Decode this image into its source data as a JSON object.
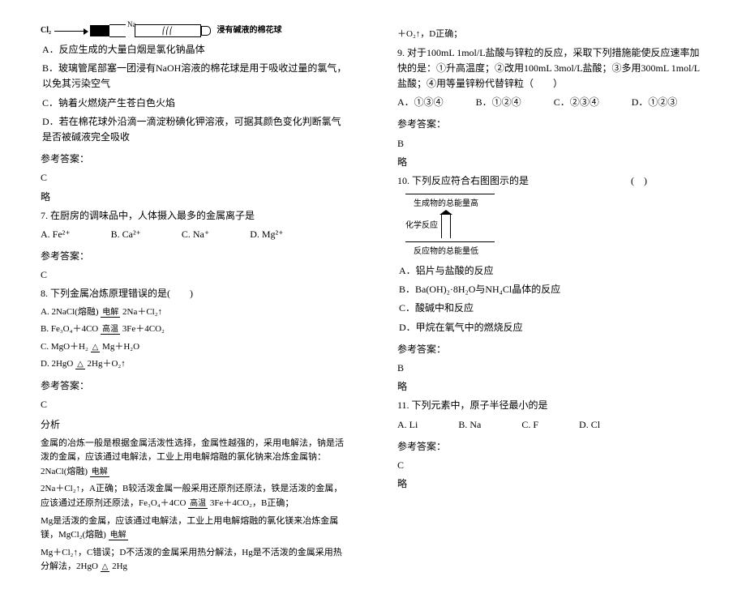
{
  "left": {
    "diagram": {
      "cl2": "Cl₂",
      "na": "Na",
      "cotton": "浸有碱液的棉花球"
    },
    "q_opts": {
      "A": "A．反应生成的大量白烟是氯化钠晶体",
      "B": "B．玻璃管尾部塞一团浸有NaOH溶液的棉花球是用于吸收过量的氯气，以免其污染空气",
      "C": "C．钠着火燃烧产生苍白色火焰",
      "D": "D．若在棉花球外沿滴一滴淀粉碘化钾溶液，可据其颜色变化判断氯气是否被碱液完全吸收"
    },
    "ref": "参考答案：",
    "ans6": "C",
    "omit": "略",
    "q7": "7. 在厨房的调味品中，人体摄入最多的金属离子是",
    "q7opts": {
      "A": "A. Fe²⁺",
      "B": "B. Ca²⁺",
      "C": "C. Na⁺",
      "D": "D. Mg²⁺"
    },
    "ans7": "C",
    "q8": "8. 下列金属冶炼原理错误的是(　　)",
    "q8A": "A. 2NaCl(熔融) ",
    "q8A_cond": "电解",
    "q8A_tail": " 2Na＋Cl₂↑",
    "q8B": "B. Fe₃O₄＋4CO ",
    "q8B_cond": "高温",
    "q8B_tail": " 3Fe＋4CO₂",
    "q8C": "C. MgO＋H₂ ",
    "q8C_cond": "△",
    "q8C_tail": " Mg＋H₂O",
    "q8D": "D. 2HgO ",
    "q8D_cond": "△",
    "q8D_tail": " 2Hg＋O₂↑",
    "ans8": "C",
    "analysis_label": "分析",
    "analysis_p1a": "金属的冶炼一般是根据金属活泼性选择，金属性越强的，采用电解法，钠是活泼的金属，应该通过电解法，工业上用电解熔融的氯化钠来冶炼金属钠：2NaCl(熔融) ",
    "analysis_cond1": "电解",
    "analysis_p1b": " 2Na＋Cl₂↑，A正确；B较活泼金属一般采用还原剂还原法，铁是活泼的金属，应该通过还原剂还原法，Fe₃O₄＋4CO ",
    "analysis_cond2": "高温",
    "analysis_p1c": " 3Fe＋4CO₂，B正确；",
    "analysis_p2a": "Mg是活泼的金属，应该通过电解法，工业上用电解熔融的氯化镁来冶炼金属镁，MgCl₂(熔融) ",
    "analysis_cond3": "电解",
    "analysis_p2b": " Mg＋Cl₂↑，C错误；D不活泼的金属采用热分解法，Hg是不活泼的金属采用热分解法，2HgO ",
    "analysis_cond4": "△",
    "analysis_p2c": " 2Hg"
  },
  "right": {
    "top_tail": "＋O₂↑，D正确；",
    "q9": "9. 对于100mL 1mol/L盐酸与锌粒的反应，采取下列措施能使反应速率加快的是：①升高温度；②改用100mL 3mol/L盐酸；③多用300mL 1mol/L盐酸；④用等量锌粉代替锌粒（　　）",
    "q9opts": {
      "A": "A．①③④",
      "B": "B．①②④",
      "C": "C．②③④",
      "D": "D．①②③"
    },
    "ref": "参考答案：",
    "ans9": "B",
    "omit": "略",
    "q10": "10. 下列反应符合右图图示的是",
    "q10_blank": "(　)",
    "energy": {
      "top": "生成物的总能量高",
      "mid": "化学反应",
      "bottom": "反应物的总能量低"
    },
    "q10opts": {
      "A": "A．铝片与盐酸的反应",
      "B": "B．Ba(OH)₂·8H₂O与NH₄Cl晶体的反应",
      "C": "C．酸碱中和反应",
      "D": "D．甲烷在氧气中的燃烧反应"
    },
    "ans10": "B",
    "q11": "11. 下列元素中，原子半径最小的是",
    "q11opts": {
      "A": "A. Li",
      "B": "B. Na",
      "C": "C. F",
      "D": "D. Cl"
    },
    "ans11": "C"
  }
}
